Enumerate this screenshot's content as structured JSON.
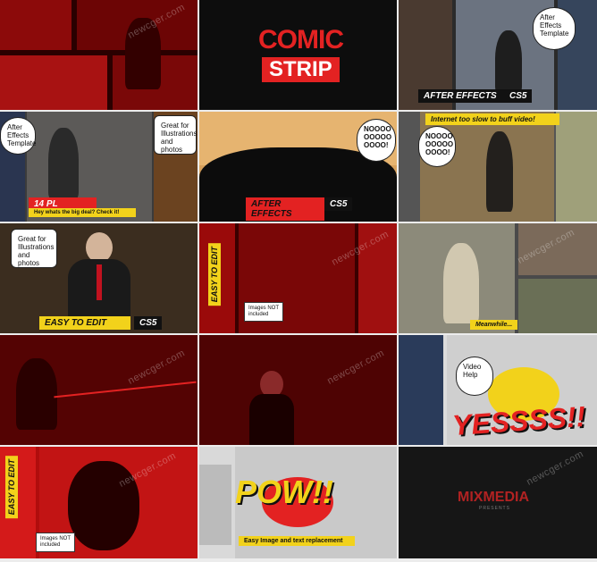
{
  "tiles": {
    "t02": {
      "title_top": "COMIC",
      "title_bottom": "STRIP"
    },
    "t03": {
      "bubble": "After Effects Template",
      "banner": "AFTER EFFECTS",
      "tag": "CS5"
    },
    "t04": {
      "bubble_left": "After Effects Template",
      "bubble_right": "Great for Illustrations and photos",
      "banner_top": "14 PL",
      "banner_bottom": "Hey whats the big deal? Check it!"
    },
    "t05": {
      "bubble": "NOOOO OOOOO OOOO!",
      "banner": "AFTER EFFECTS",
      "tag": "CS5"
    },
    "t06": {
      "caption": "Internet too slow to buff video!",
      "bubble": "NOOOO OOOOO OOOO!"
    },
    "t07": {
      "bubble": "Great for Illustrations and photos",
      "banner": "EASY TO EDIT",
      "tag": "CS5"
    },
    "t08": {
      "vertical": "EASY TO EDIT",
      "box": "Images NOT included"
    },
    "t09": {
      "caption": "Meanwhile..."
    },
    "t12": {
      "bubble": "Video Help",
      "big_text": "YESSSS!!"
    },
    "t13": {
      "vertical": "EASY TO EDIT",
      "box": "Images NOT included"
    },
    "t14": {
      "big_text": "POW!!",
      "banner": "Easy Image and text replacement"
    },
    "t15": {
      "title": "MIXMEDIA",
      "subtitle": "PRESENTS"
    }
  },
  "watermark": "newcger.com",
  "colors": {
    "red": "#e32222",
    "yellow": "#f2d21b",
    "dark": "#111111",
    "blue": "#3e6fa3"
  }
}
